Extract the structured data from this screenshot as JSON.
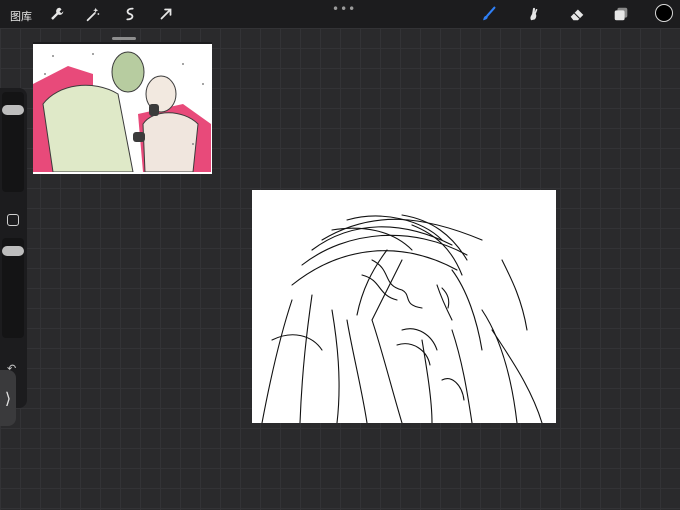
{
  "topbar": {
    "gallery_label": "图库",
    "left_tools": [
      "wrench-icon",
      "magic-wand-icon",
      "selection-icon",
      "transform-icon"
    ],
    "right_tools": [
      "brush-icon",
      "smudge-icon",
      "eraser-icon",
      "layers-icon"
    ],
    "active_tool": "brush-icon",
    "accent_color": "#2f7ff5",
    "current_color": "#000000",
    "more_glyph": "•••"
  },
  "sidebar": {
    "size_slider_level": 0.1,
    "opacity_slider_level": 0.1,
    "modify_glyph": "",
    "undo_glyph": "↶",
    "redo_glyph": "↷",
    "collapse_glyph": "⟩"
  },
  "reference": {
    "colors": [
      "#e8f0d8",
      "#e84a7a",
      "#b7cca0",
      "#f0e6de",
      "#3b3b3b"
    ]
  },
  "canvas": {
    "background": "#ffffff",
    "stroke": "#111111"
  }
}
